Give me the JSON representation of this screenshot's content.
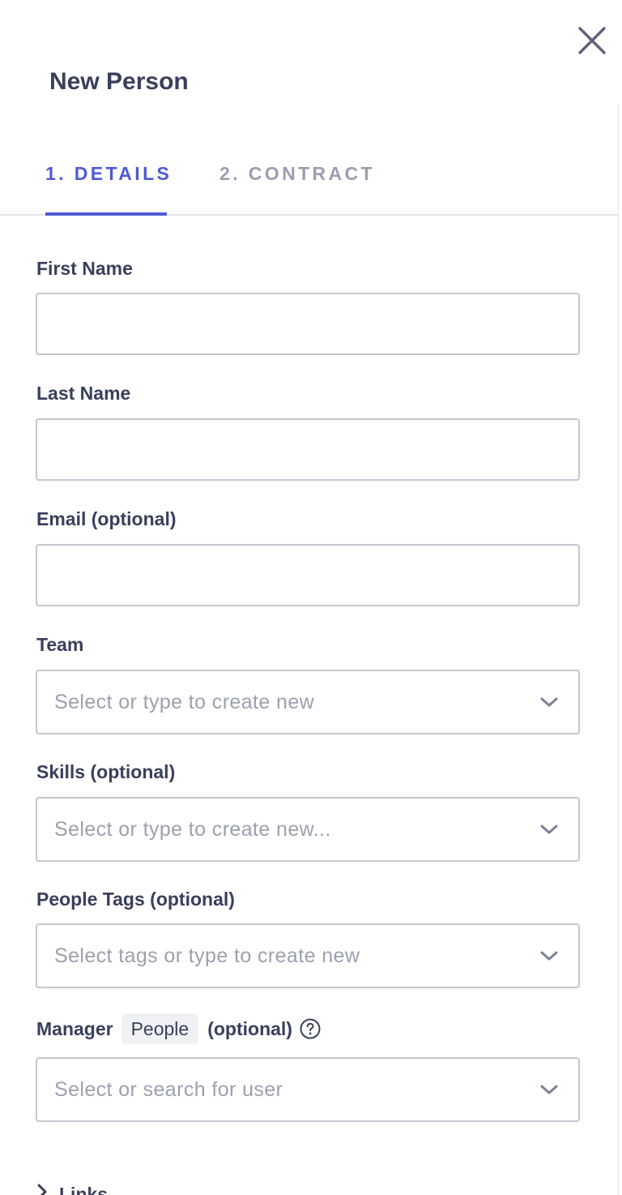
{
  "header": {
    "title": "New Person",
    "close_icon": "close-icon"
  },
  "tabs": [
    {
      "label": "1. DETAILS",
      "active": true
    },
    {
      "label": "2. CONTRACT",
      "active": false
    }
  ],
  "fields": {
    "first_name": {
      "label": "First Name",
      "value": ""
    },
    "last_name": {
      "label": "Last Name",
      "value": ""
    },
    "email": {
      "label": "Email (optional)",
      "value": ""
    },
    "team": {
      "label": "Team",
      "placeholder": "Select or type to create new"
    },
    "skills": {
      "label": "Skills (optional)",
      "placeholder": "Select or type to create new..."
    },
    "people_tags": {
      "label": "People Tags (optional)",
      "placeholder": "Select tags or type to create new"
    },
    "manager": {
      "label": "Manager",
      "badge": "People",
      "optional": "(optional)",
      "help_icon": "help-circle-icon",
      "placeholder": "Select or search for user"
    }
  },
  "links_section": {
    "label": "Links",
    "icon": "chevron-right-icon"
  },
  "colors": {
    "accent": "#4d5bd4",
    "text": "#3a3f5c",
    "muted": "#9b9eaf",
    "border": "#c5c7d0"
  }
}
